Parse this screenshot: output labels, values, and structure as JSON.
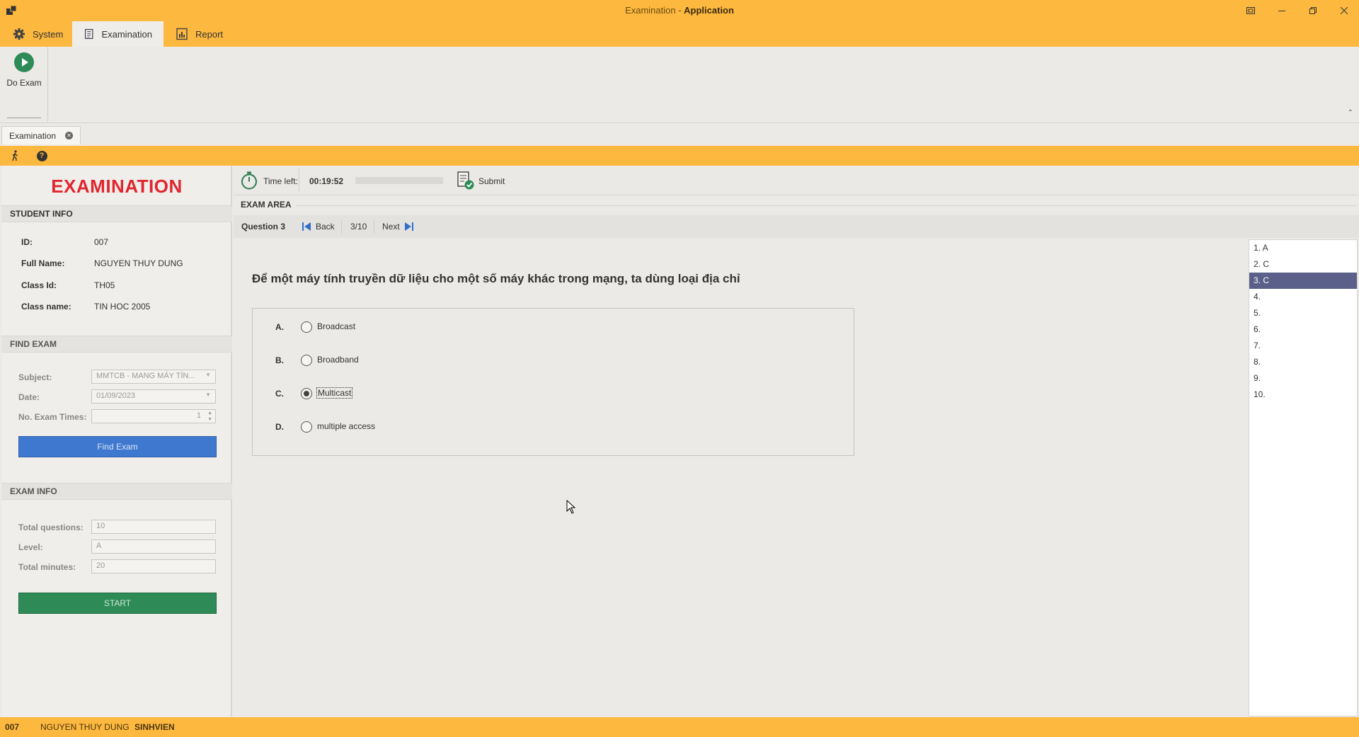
{
  "window": {
    "title_prefix": "Examination - ",
    "title_app": "Application",
    "controls": [
      "restore-docked",
      "minimize",
      "maximize",
      "close"
    ]
  },
  "ribbon": {
    "tabs": [
      {
        "label": "System",
        "icon": "gear-icon"
      },
      {
        "label": "Examination",
        "icon": "document-icon"
      },
      {
        "label": "Report",
        "icon": "report-icon"
      }
    ],
    "active_tab": "Examination",
    "buttons": [
      {
        "label": "Do Exam",
        "icon": "play-icon"
      }
    ]
  },
  "document_tabs": [
    {
      "label": "Examination"
    }
  ],
  "toolbar_icons": [
    "walking-person-icon",
    "help-icon"
  ],
  "left_panel": {
    "title": "EXAMINATION",
    "student_info": {
      "header": "STUDENT INFO",
      "id_label": "ID:",
      "id_value": "007",
      "fullname_label": "Full Name:",
      "fullname_value": "NGUYEN THUY  DUNG",
      "classid_label": "Class Id:",
      "classid_value": "TH05",
      "classname_label": "Class name:",
      "classname_value": "TIN HOC 2005"
    },
    "find_exam": {
      "header": "FIND EXAM",
      "subject_label": "Subject:",
      "subject_value": "MMTCB - MANG MÁY TÍN...",
      "date_label": "Date:",
      "date_value": "01/09/2023",
      "times_label": "No. Exam Times:",
      "times_value": "1",
      "button_label": "Find Exam"
    },
    "exam_info": {
      "header": "EXAM INFO",
      "total_questions_label": "Total questions:",
      "total_questions_value": "10",
      "level_label": "Level:",
      "level_value": "A",
      "total_minutes_label": "Total minutes:",
      "total_minutes_value": "20",
      "button_label": "START"
    }
  },
  "timer": {
    "label": "Time left:",
    "value": "00:19:52",
    "progress_fraction": 0.0,
    "submit_label": "Submit"
  },
  "exam_area": {
    "header": "EXAM AREA",
    "question_label": "Question 3",
    "back_label": "Back",
    "position": "3/10",
    "next_label": "Next",
    "question_text": "Để một máy tính truyền dữ liệu cho một số máy khác trong mạng, ta dùng loại địa chỉ",
    "options": [
      {
        "letter": "A.",
        "text": "Broadcast",
        "checked": false
      },
      {
        "letter": "B.",
        "text": "Broadband",
        "checked": false
      },
      {
        "letter": "C.",
        "text": "Multicast",
        "checked": true
      },
      {
        "letter": "D.",
        "text": "multiple access",
        "checked": false
      }
    ]
  },
  "answer_list": [
    {
      "label": "1. A",
      "selected": false
    },
    {
      "label": "2. C",
      "selected": false
    },
    {
      "label": "3. C",
      "selected": true
    },
    {
      "label": "4.",
      "selected": false
    },
    {
      "label": "5.",
      "selected": false
    },
    {
      "label": "6.",
      "selected": false
    },
    {
      "label": "7.",
      "selected": false
    },
    {
      "label": "8.",
      "selected": false
    },
    {
      "label": "9.",
      "selected": false
    },
    {
      "label": "10.",
      "selected": false
    }
  ],
  "status_bar": {
    "id": "007",
    "name": "NGUYEN THUY  DUNG",
    "role": "SINHVIEN"
  },
  "colors": {
    "accent": "#fdb83f",
    "title_red": "#e0262f",
    "find_button": "#3f79cf",
    "start_button": "#2e8b57",
    "selected_answer": "#5a6089"
  }
}
